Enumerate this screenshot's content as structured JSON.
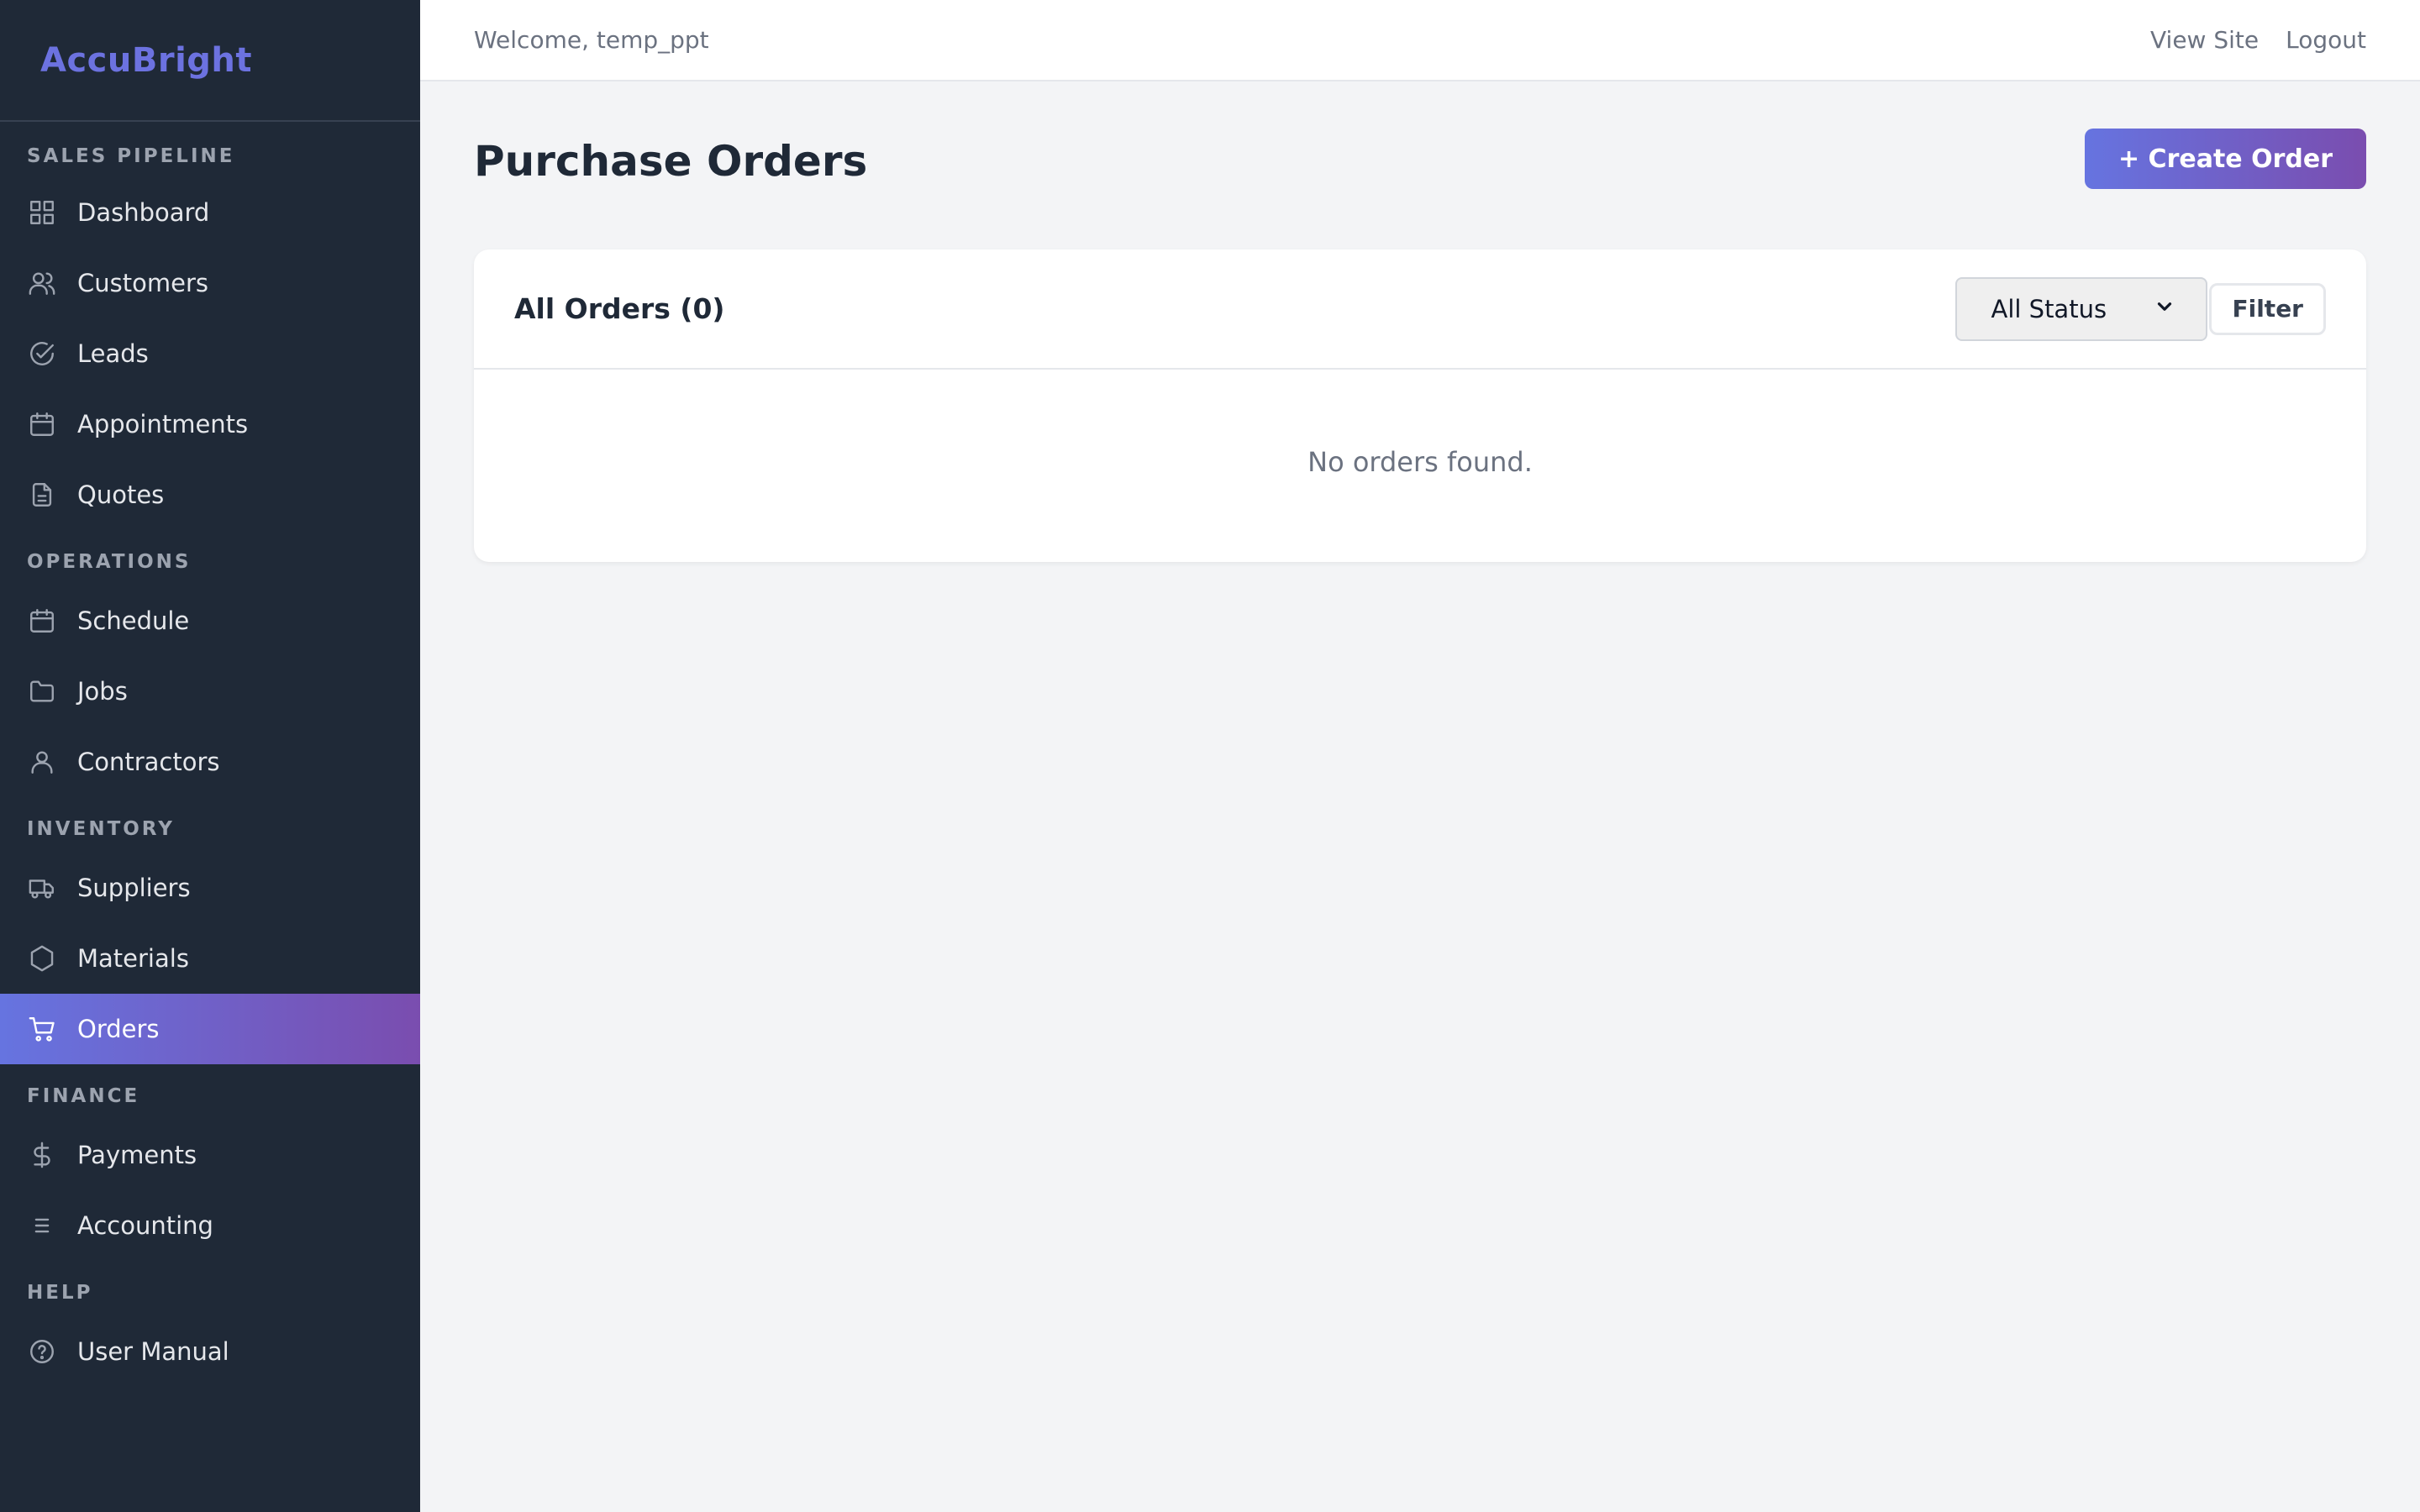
{
  "sidebar": {
    "brand": "AccuBright",
    "sections": [
      {
        "title": "SALES PIPELINE",
        "items": [
          {
            "label": "Dashboard",
            "icon": "grid-icon"
          },
          {
            "label": "Customers",
            "icon": "users-icon"
          },
          {
            "label": "Leads",
            "icon": "check-circle-icon"
          },
          {
            "label": "Appointments",
            "icon": "calendar-icon"
          },
          {
            "label": "Quotes",
            "icon": "document-icon"
          }
        ]
      },
      {
        "title": "OPERATIONS",
        "items": [
          {
            "label": "Schedule",
            "icon": "calendar-icon"
          },
          {
            "label": "Jobs",
            "icon": "folder-icon"
          },
          {
            "label": "Contractors",
            "icon": "user-icon"
          }
        ]
      },
      {
        "title": "INVENTORY",
        "items": [
          {
            "label": "Suppliers",
            "icon": "truck-icon"
          },
          {
            "label": "Materials",
            "icon": "hexagon-icon"
          },
          {
            "label": "Orders",
            "icon": "cart-icon",
            "active": true
          }
        ]
      },
      {
        "title": "FINANCE",
        "items": [
          {
            "label": "Payments",
            "icon": "dollar-icon"
          },
          {
            "label": "Accounting",
            "icon": "list-icon"
          }
        ]
      },
      {
        "title": "HELP",
        "items": [
          {
            "label": "User Manual",
            "icon": "help-circle-icon"
          }
        ]
      }
    ]
  },
  "topbar": {
    "welcome": "Welcome, temp_ppt",
    "view_site": "View Site",
    "logout": "Logout"
  },
  "main": {
    "title": "Purchase Orders",
    "create_button": "+ Create Order",
    "card": {
      "title": "All Orders (0)",
      "status_filter": {
        "selected": "All Status"
      },
      "filter_button": "Filter",
      "empty_message": "No orders found."
    }
  },
  "colors": {
    "sidebar_bg": "#1f2937",
    "brand": "#6c72e0",
    "accent_start": "#6674e0",
    "accent_end": "#7a4daf",
    "page_bg": "#f3f4f6"
  }
}
